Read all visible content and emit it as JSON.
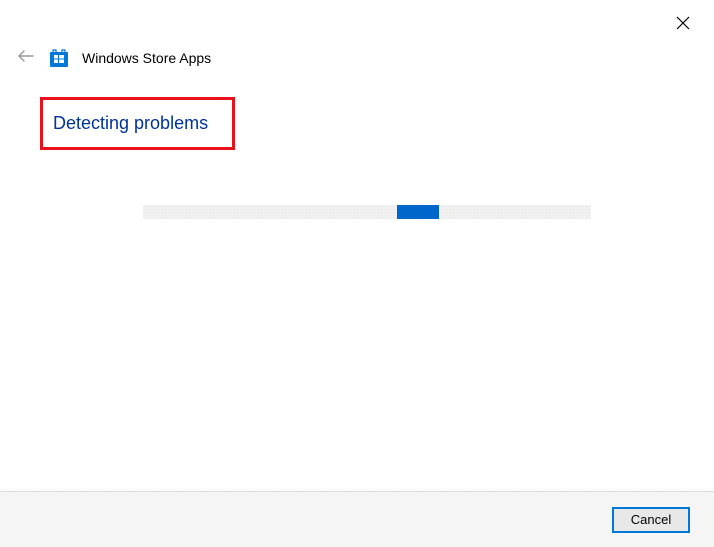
{
  "window": {
    "title": "Windows Store Apps"
  },
  "main": {
    "status_heading": "Detecting problems"
  },
  "footer": {
    "cancel_label": "Cancel"
  }
}
